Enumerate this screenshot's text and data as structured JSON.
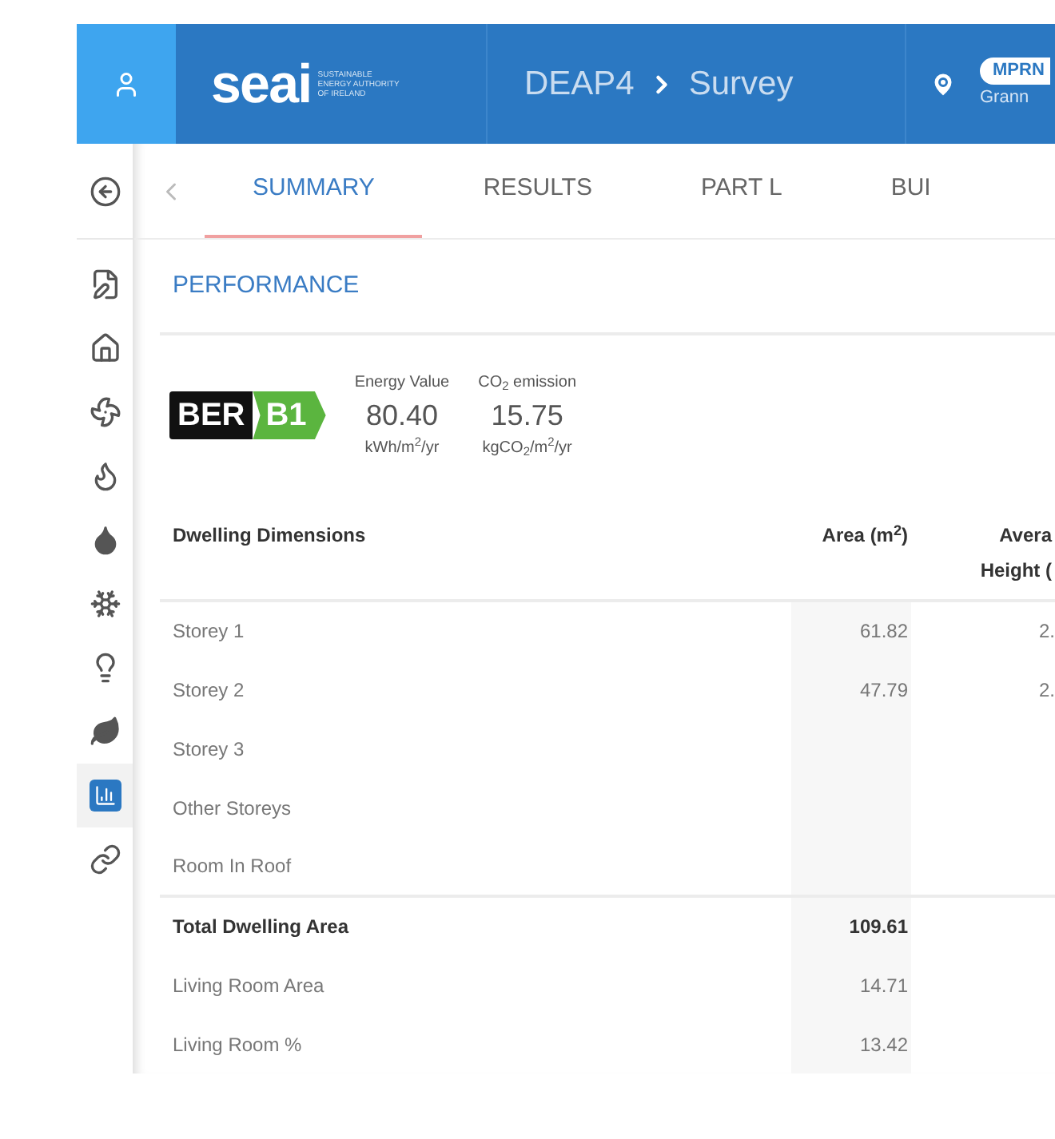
{
  "header": {
    "logo": "seai",
    "logo_caption": [
      "SUSTAINABLE",
      "ENERGY AUTHORITY",
      "OF IRELAND"
    ],
    "breadcrumb": [
      "DEAP4",
      "Survey"
    ],
    "badge": "MPRN",
    "location": "Grann"
  },
  "sidebar": {
    "items": [
      {
        "kind": "back",
        "selected": false
      },
      {
        "kind": "survey",
        "selected": false
      },
      {
        "kind": "house",
        "selected": false
      },
      {
        "kind": "fan",
        "selected": false
      },
      {
        "kind": "flame",
        "selected": false
      },
      {
        "kind": "drop",
        "selected": false
      },
      {
        "kind": "snow",
        "selected": false
      },
      {
        "kind": "bulb",
        "selected": false
      },
      {
        "kind": "leaf",
        "selected": false
      },
      {
        "kind": "chart",
        "selected": true
      },
      {
        "kind": "link",
        "selected": false
      }
    ]
  },
  "tabs": [
    {
      "label": "SUMMARY",
      "selected": true
    },
    {
      "label": "RESULTS",
      "selected": false
    },
    {
      "label": "PART L",
      "selected": false
    },
    {
      "label": "BUI",
      "selected": false
    }
  ],
  "section": {
    "title": "PERFORMANCE"
  },
  "ber": {
    "label": "BER",
    "rating": "B1",
    "color": "#5bb53f"
  },
  "metrics": [
    {
      "label": "Energy Value",
      "value": "80.40",
      "unit": "kWh/m$^{2}$/yr"
    },
    {
      "label": "CO$_{2}$ emission",
      "value": "15.75",
      "unit": "kgCO$_{2}$/m$^{2}$/yr"
    }
  ],
  "table": {
    "columns": [
      "Dwelling Dimensions",
      "Area (m$^{2}$)",
      "Avera Height ("
    ],
    "rows": [
      {
        "kind": "normal",
        "cells": [
          "Storey 1",
          "61.82",
          "2."
        ]
      },
      {
        "kind": "normal",
        "cells": [
          "Storey 2",
          "47.79",
          "2."
        ]
      },
      {
        "kind": "normal",
        "cells": [
          "Storey 3",
          "",
          ""
        ]
      },
      {
        "kind": "normal",
        "cells": [
          "Other Storeys",
          "",
          ""
        ]
      },
      {
        "kind": "normal",
        "cells": [
          "Room In Roof",
          "",
          ""
        ]
      },
      {
        "kind": "total",
        "cells": [
          "Total Dwelling Area",
          "109.61",
          ""
        ]
      },
      {
        "kind": "normal",
        "cells": [
          "Living Room Area",
          "14.71",
          ""
        ]
      },
      {
        "kind": "normal",
        "cells": [
          "Living Room %",
          "13.42",
          ""
        ]
      }
    ]
  }
}
